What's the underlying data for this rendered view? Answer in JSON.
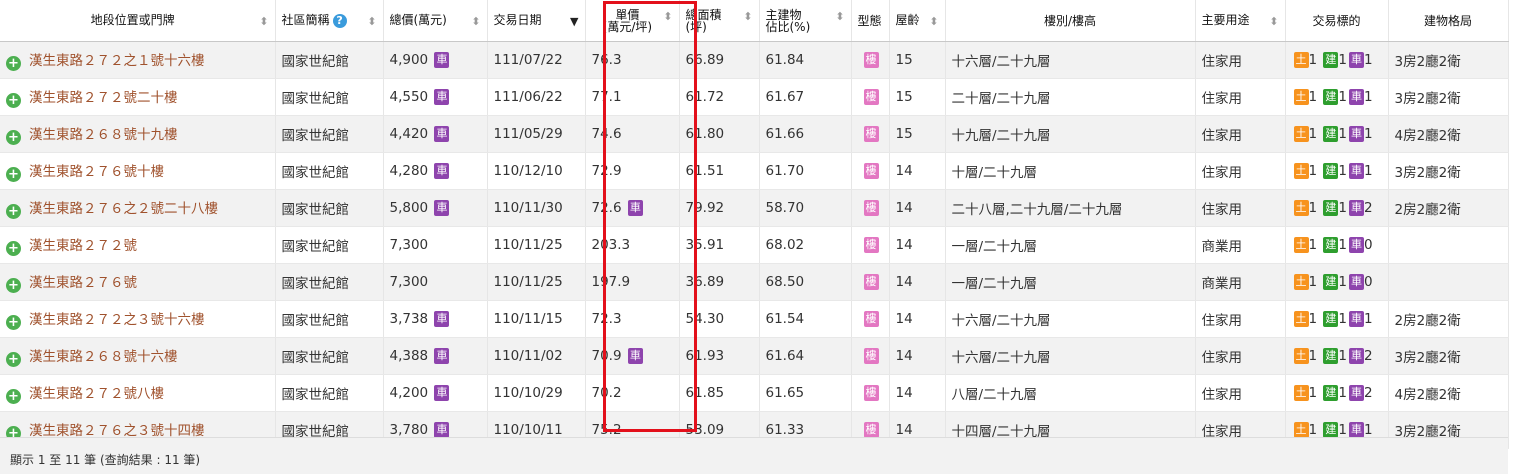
{
  "headers": {
    "location": "地段位置或門牌",
    "community": "社區簡稱",
    "total": "總價(萬元)",
    "date": "交易日期",
    "unit_price": "單價\n(萬元/坪)",
    "area": "總面積\n(坪)",
    "main_ratio": "主建物\n佔比(%)",
    "type": "型態",
    "age": "屋齡",
    "floor": "樓別/樓高",
    "use": "主要用途",
    "target": "交易標的",
    "layout": "建物格局"
  },
  "badges": {
    "car": "車",
    "lou": "樓",
    "tu": "土",
    "jian": "建"
  },
  "rows": [
    {
      "addr": "漢生東路２７２之１號十六樓",
      "community": "國家世紀館",
      "total": "4,900",
      "total_car": true,
      "date": "111/07/22",
      "unit": "76.3",
      "unit_car": false,
      "area": "66.89",
      "ratio": "61.84",
      "age": "15",
      "floor": "十六層/二十九層",
      "use": "住家用",
      "tu": "1",
      "jian": "1",
      "che": "1",
      "layout": "3房2廳2衛"
    },
    {
      "addr": "漢生東路２７２號二十樓",
      "community": "國家世紀館",
      "total": "4,550",
      "total_car": true,
      "date": "111/06/22",
      "unit": "77.1",
      "unit_car": false,
      "area": "61.72",
      "ratio": "61.67",
      "age": "15",
      "floor": "二十層/二十九層",
      "use": "住家用",
      "tu": "1",
      "jian": "1",
      "che": "1",
      "layout": "3房2廳2衛"
    },
    {
      "addr": "漢生東路２６８號十九樓",
      "community": "國家世紀館",
      "total": "4,420",
      "total_car": true,
      "date": "111/05/29",
      "unit": "74.6",
      "unit_car": false,
      "area": "61.80",
      "ratio": "61.66",
      "age": "15",
      "floor": "十九層/二十九層",
      "use": "住家用",
      "tu": "1",
      "jian": "1",
      "che": "1",
      "layout": "4房2廳2衛"
    },
    {
      "addr": "漢生東路２７６號十樓",
      "community": "國家世紀館",
      "total": "4,280",
      "total_car": true,
      "date": "110/12/10",
      "unit": "72.9",
      "unit_car": false,
      "area": "61.51",
      "ratio": "61.70",
      "age": "14",
      "floor": "十層/二十九層",
      "use": "住家用",
      "tu": "1",
      "jian": "1",
      "che": "1",
      "layout": "3房2廳2衛"
    },
    {
      "addr": "漢生東路２７６之２號二十八樓",
      "community": "國家世紀館",
      "total": "5,800",
      "total_car": true,
      "date": "110/11/30",
      "unit": "72.6",
      "unit_car": true,
      "area": "79.92",
      "ratio": "58.70",
      "age": "14",
      "floor": "二十八層,二十九層/二十九層",
      "use": "住家用",
      "tu": "1",
      "jian": "1",
      "che": "2",
      "layout": "2房2廳2衛"
    },
    {
      "addr": "漢生東路２７２號",
      "community": "國家世紀館",
      "total": "7,300",
      "total_car": false,
      "date": "110/11/25",
      "unit": "203.3",
      "unit_car": false,
      "area": "35.91",
      "ratio": "68.02",
      "age": "14",
      "floor": "一層/二十九層",
      "use": "商業用",
      "tu": "1",
      "jian": "1",
      "che": "0",
      "layout": ""
    },
    {
      "addr": "漢生東路２７６號",
      "community": "國家世紀館",
      "total": "7,300",
      "total_car": false,
      "date": "110/11/25",
      "unit": "197.9",
      "unit_car": false,
      "area": "36.89",
      "ratio": "68.50",
      "age": "14",
      "floor": "一層/二十九層",
      "use": "商業用",
      "tu": "1",
      "jian": "1",
      "che": "0",
      "layout": ""
    },
    {
      "addr": "漢生東路２７２之３號十六樓",
      "community": "國家世紀館",
      "total": "3,738",
      "total_car": true,
      "date": "110/11/15",
      "unit": "72.3",
      "unit_car": false,
      "area": "54.30",
      "ratio": "61.54",
      "age": "14",
      "floor": "十六層/二十九層",
      "use": "住家用",
      "tu": "1",
      "jian": "1",
      "che": "1",
      "layout": "2房2廳2衛"
    },
    {
      "addr": "漢生東路２６８號十六樓",
      "community": "國家世紀館",
      "total": "4,388",
      "total_car": true,
      "date": "110/11/02",
      "unit": "70.9",
      "unit_car": true,
      "area": "61.93",
      "ratio": "61.64",
      "age": "14",
      "floor": "十六層/二十九層",
      "use": "住家用",
      "tu": "1",
      "jian": "1",
      "che": "2",
      "layout": "3房2廳2衛"
    },
    {
      "addr": "漢生東路２７２號八樓",
      "community": "國家世紀館",
      "total": "4,200",
      "total_car": true,
      "date": "110/10/29",
      "unit": "70.2",
      "unit_car": false,
      "area": "61.85",
      "ratio": "61.65",
      "age": "14",
      "floor": "八層/二十九層",
      "use": "住家用",
      "tu": "1",
      "jian": "1",
      "che": "2",
      "layout": "4房2廳2衛"
    },
    {
      "addr": "漢生東路２７６之３號十四樓",
      "community": "國家世紀館",
      "total": "3,780",
      "total_car": true,
      "date": "110/10/11",
      "unit": "75.2",
      "unit_car": false,
      "area": "53.09",
      "ratio": "61.33",
      "age": "14",
      "floor": "十四層/二十九層",
      "use": "住家用",
      "tu": "1",
      "jian": "1",
      "che": "1",
      "layout": "3房2廳2衛"
    }
  ],
  "footer": "顯示 1 至 11 筆 (查詢結果 : 11 筆)",
  "colors": {
    "highlight": "#e3101b",
    "addr": "#a0522d"
  }
}
